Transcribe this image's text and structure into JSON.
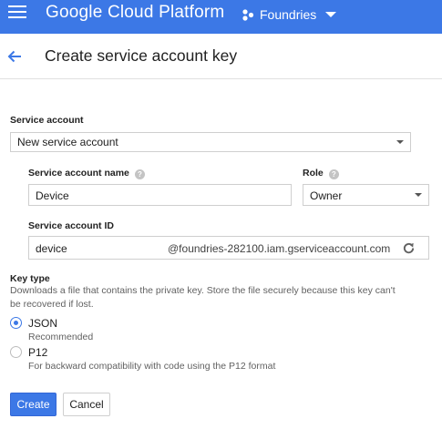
{
  "topbar": {
    "brand": "Google Cloud Platform",
    "project": "Foundries"
  },
  "header": {
    "title": "Create service account key"
  },
  "form": {
    "service_account": {
      "label": "Service account",
      "value": "New service account"
    },
    "name": {
      "label": "Service account name",
      "value": "Device"
    },
    "role": {
      "label": "Role",
      "value": "Owner"
    },
    "account_id": {
      "label": "Service account ID",
      "value": "device",
      "suffix": "@foundries-282100.iam.gserviceaccount.com"
    },
    "key_type": {
      "label": "Key type",
      "description_line1": "Downloads a file that contains the private key. Store the file securely because this key can't",
      "description_line2": "be recovered if lost.",
      "options": [
        {
          "label": "JSON",
          "sub": "Recommended",
          "selected": true
        },
        {
          "label": "P12",
          "sub": "For backward compatibility with code using the P12 format",
          "selected": false
        }
      ]
    }
  },
  "buttons": {
    "create": "Create",
    "cancel": "Cancel"
  },
  "colors": {
    "accent": "#3c78e6"
  }
}
